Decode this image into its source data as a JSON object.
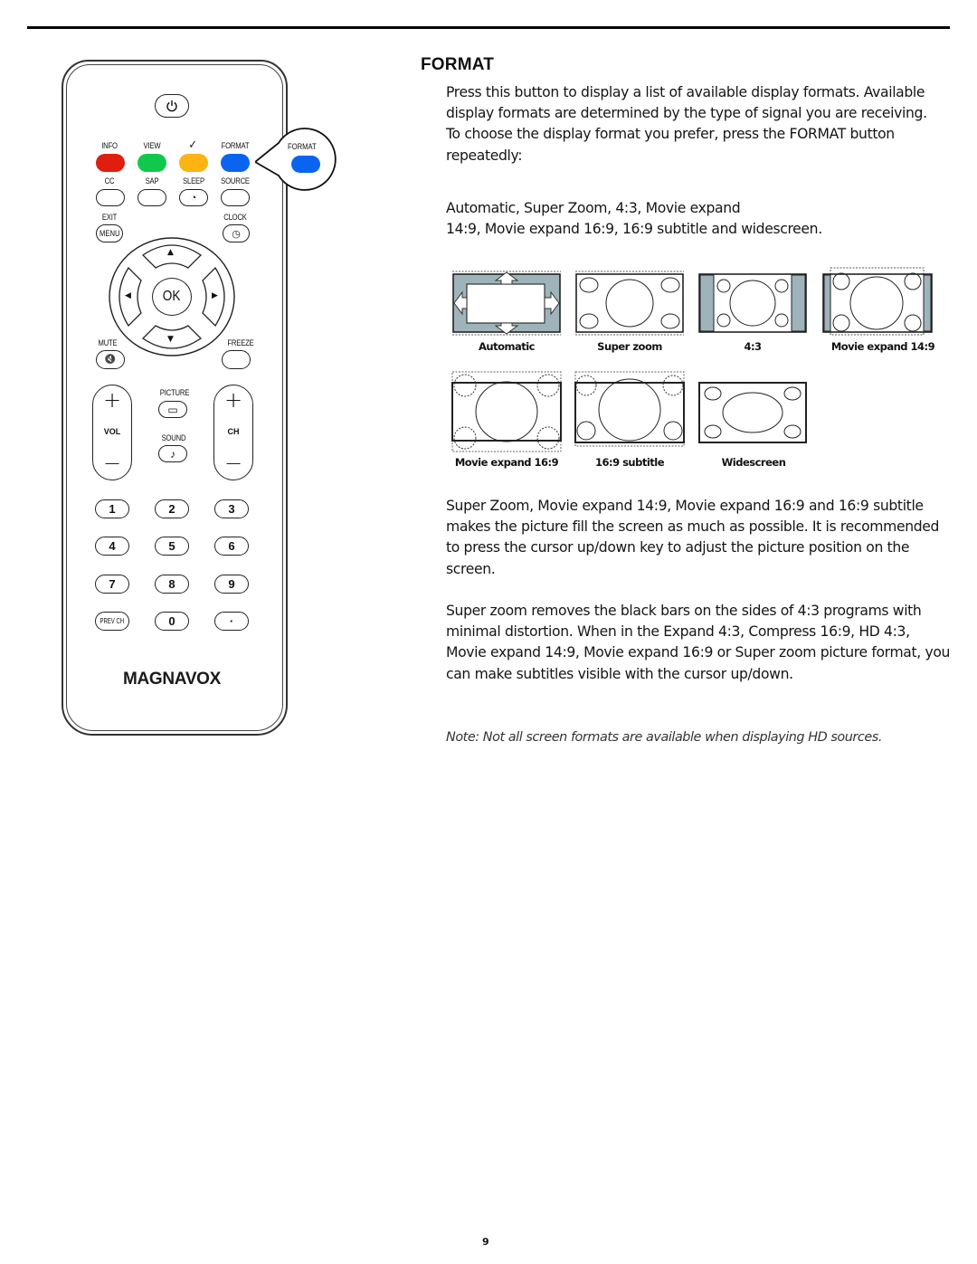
{
  "heading": "FORMAT",
  "paragraphs": {
    "intro": "Press this button to display a list of available display formats. Available display formats are determined by the type of signal you are receiving.",
    "choose": "To choose the display format you prefer, press the FORMAT button repeatedly:",
    "sequence_line1": "Automatic, Super Zoom, 4:3, Movie expand",
    "sequence_line2": "14:9, Movie expand 16:9, 16:9 subtitle and widescreen.",
    "fill": "Super Zoom, Movie expand 14:9, Movie expand 16:9 and 16:9 subtitle makes the picture fill the screen as much as possible. It is recommended to press the cursor up/down key to adjust the picture position on the screen.",
    "superzoom": "Super zoom removes the black bars on the sides of 4:3 programs with minimal distortion. When in the Expand 4:3, Compress 16:9, HD 4:3, Movie expand 14:9, Movie expand 16:9 or Super zoom picture format, you can make subtitles visible with the cursor up/down.",
    "note": "Note: Not all screen formats are available when displaying HD sources."
  },
  "formats": [
    {
      "label": "Automatic",
      "icon": "automatic-format-icon"
    },
    {
      "label": "Super zoom",
      "icon": "super-zoom-format-icon"
    },
    {
      "label": "4:3",
      "icon": "4-3-format-icon"
    },
    {
      "label": "Movie expand 14:9",
      "icon": "movie-expand-14-9-format-icon"
    },
    {
      "label": "Movie expand 16:9",
      "icon": "movie-expand-16-9-format-icon"
    },
    {
      "label": "16:9 subtitle",
      "icon": "16-9-subtitle-format-icon"
    },
    {
      "label": "Widescreen",
      "icon": "widescreen-format-icon"
    }
  ],
  "remote": {
    "brand": "MAGNAVOX",
    "power_icon": "power-icon",
    "color_row": {
      "labels": [
        "INFO",
        "VIEW",
        "✓",
        "FORMAT"
      ],
      "colors": [
        "#e01e10",
        "#12c84c",
        "#fbb414",
        "#0a64f0"
      ]
    },
    "row2": {
      "labels": [
        "CC",
        "SAP",
        "SLEEP",
        "SOURCE"
      ],
      "sleep_glyph": "◔"
    },
    "exit_label": "EXIT",
    "menu_label": "MENU",
    "clock_label": "CLOCK",
    "clock_glyph": "◷",
    "ok_label": "OK",
    "arrows": {
      "up": "▲",
      "down": "▼",
      "left": "◀",
      "right": "▶"
    },
    "mute_label": "MUTE",
    "mute_glyph": "🔇",
    "freeze_label": "FREEZE",
    "vol": {
      "label": "VOL",
      "plus": "+",
      "minus": "−"
    },
    "ch": {
      "label": "CH",
      "plus": "+",
      "minus": "−"
    },
    "picture_label": "PICTURE",
    "picture_glyph": "▭",
    "sound_label": "SOUND",
    "sound_glyph": "♪",
    "numbers": [
      "1",
      "2",
      "3",
      "4",
      "5",
      "6",
      "7",
      "8",
      "9",
      "PREV CH",
      "0",
      "·"
    ],
    "callout_label": "FORMAT",
    "callout_color": "#0a64f0"
  },
  "page_number": "9"
}
